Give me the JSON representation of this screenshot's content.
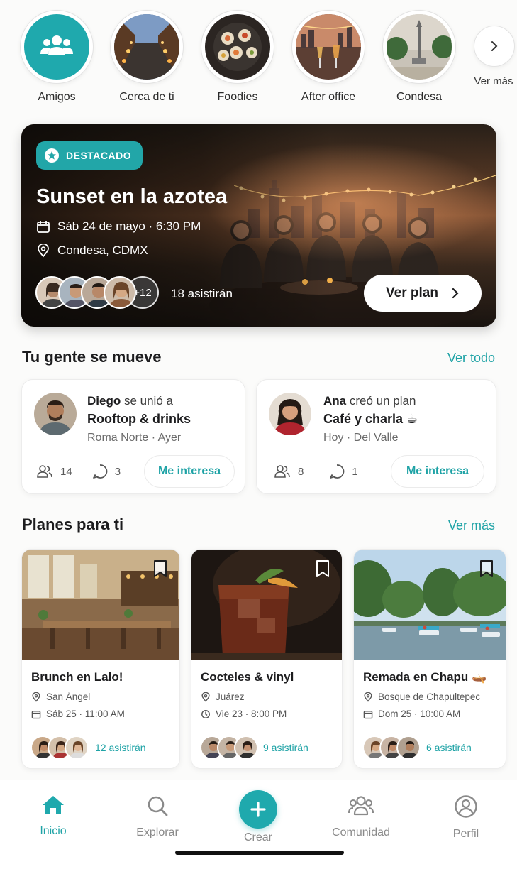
{
  "stories": [
    {
      "label": "Amigos"
    },
    {
      "label": "Cerca de ti"
    },
    {
      "label": "Foodies"
    },
    {
      "label": "After office"
    },
    {
      "label": "Condesa"
    }
  ],
  "stories_more_label": "Ver más",
  "featured": {
    "badge": "DESTACADO",
    "title": "Sunset en la azotea",
    "date": "Sáb 24 de mayo · 6:30 PM",
    "location": "Condesa, CDMX",
    "extra_count": "+12",
    "attending": "18 asistirán",
    "cta": "Ver plan"
  },
  "activity": {
    "title": "Tu gente se mueve",
    "link": "Ver todo",
    "cards": [
      {
        "name": "Diego",
        "action": " se unió a",
        "plan": "Rooftop & drinks",
        "meta": "Roma Norte · Ayer",
        "people": "14",
        "comments": "3",
        "button": "Me interesa"
      },
      {
        "name": "Ana",
        "action": " creó un plan",
        "plan": "Café y charla ☕",
        "meta": "Hoy · Del Valle",
        "people": "8",
        "comments": "1",
        "button": "Me interesa"
      }
    ]
  },
  "plans": {
    "title": "Planes para ti",
    "link": "Ver más",
    "cards": [
      {
        "title": "Brunch en Lalo!",
        "place": "San Ángel",
        "when": "Sáb 25 · 11:00 AM",
        "attending": "12 asistirán"
      },
      {
        "title": "Cocteles & vinyl",
        "place": "Juárez",
        "when": "Vie 23 · 8:00 PM",
        "attending": "9 asistirán"
      },
      {
        "title": "Remada en Chapu 🛶",
        "place": "Bosque de Chapultepec",
        "when": "Dom 25 · 10:00 AM",
        "attending": "6 asistirán"
      }
    ]
  },
  "nav": {
    "home": "Inicio",
    "explore": "Explorar",
    "create": "Crear",
    "community": "Comunidad",
    "profile": "Perfil"
  },
  "colors": {
    "accent": "#1fa9ad",
    "text": "#1d1d1f",
    "muted": "#6b6b6b"
  }
}
